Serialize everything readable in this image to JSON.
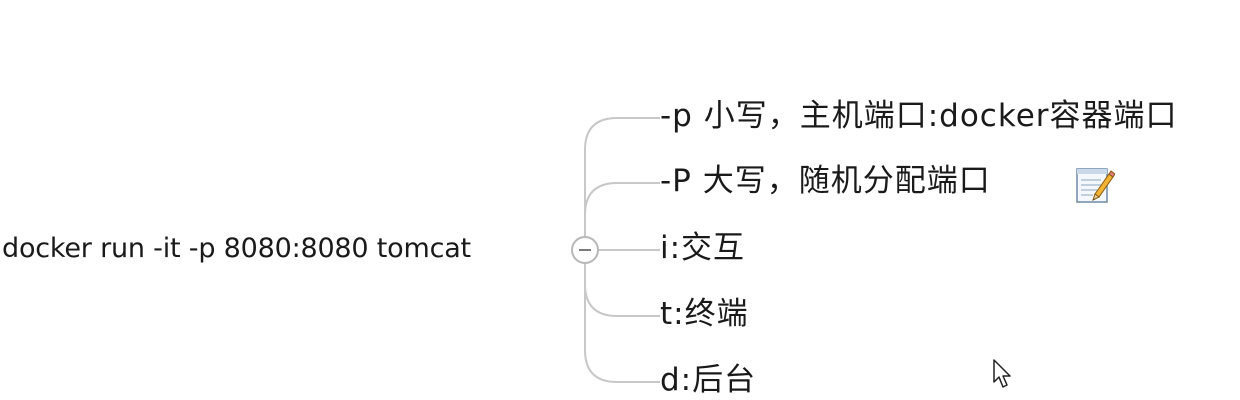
{
  "mindmap": {
    "central_topic": "docker run -it -p 8080:8080 tomcat",
    "children": [
      {
        "label": "-p 小写，主机端口:docker容器端口"
      },
      {
        "label": "-P 大写，随机分配端口"
      },
      {
        "label": "i:交互"
      },
      {
        "label": "t:终端"
      },
      {
        "label": "d:后台"
      }
    ],
    "icons": {
      "collapse": "collapse-minus-icon",
      "note": "note-icon",
      "cursor": "mouse-pointer-icon"
    },
    "colors": {
      "connector": "#c8c8c8",
      "text": "#1a1a1a"
    }
  }
}
